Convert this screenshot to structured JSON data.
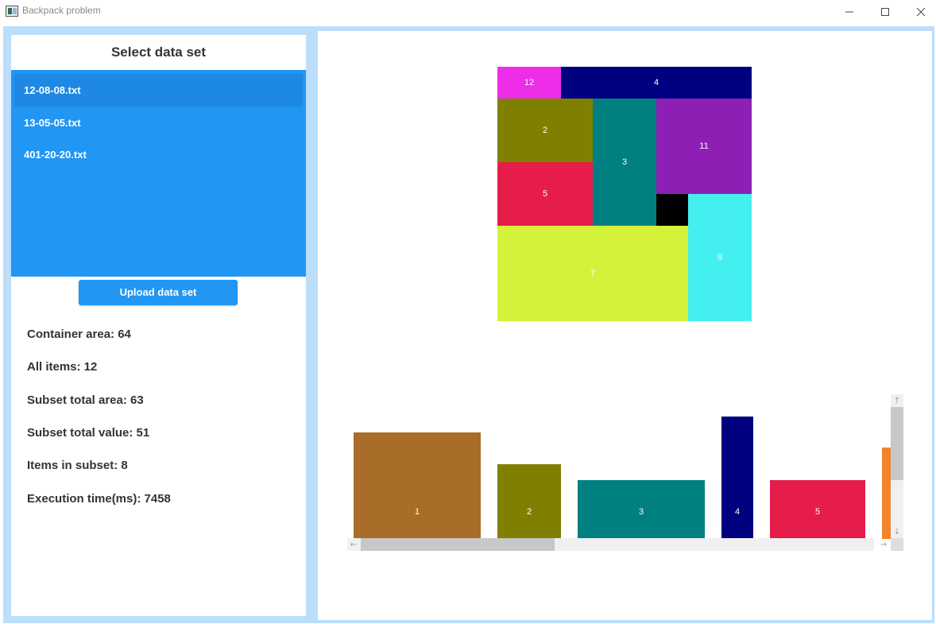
{
  "window": {
    "title": "Backpack problem",
    "minimize_icon": "minimize-icon",
    "maximize_icon": "maximize-icon",
    "close_icon": "close-icon"
  },
  "sidebar": {
    "title": "Select data set",
    "files": [
      "12-08-08.txt",
      "13-05-05.txt",
      "401-20-20.txt"
    ],
    "selected_file": "12-08-08.txt",
    "upload_label": "Upload data set",
    "accent_color": "#2196f3"
  },
  "stats": {
    "container_area": "Container area: 64",
    "all_items": "All items: 12",
    "subset_total_area": "Subset total area: 63",
    "subset_total_value": "Subset total value: 51",
    "items_in_subset": "Items in subset: 8",
    "execution_time": "Execution time(ms): 7458"
  },
  "container": {
    "grid_size": 8,
    "placements": [
      {
        "id": "12",
        "col": 0,
        "row": 0,
        "w": 2,
        "h": 1,
        "color": "#ee2de8"
      },
      {
        "id": "4",
        "col": 2,
        "row": 0,
        "w": 6,
        "h": 1,
        "color": "#000080"
      },
      {
        "id": "2",
        "col": 0,
        "row": 1,
        "w": 3,
        "h": 2,
        "color": "#808000"
      },
      {
        "id": "3",
        "col": 3,
        "row": 1,
        "w": 2,
        "h": 4,
        "color": "#008080"
      },
      {
        "id": "11",
        "col": 5,
        "row": 1,
        "w": 3,
        "h": 3,
        "color": "#8e1fb5"
      },
      {
        "id": "5",
        "col": 0,
        "row": 3,
        "w": 3,
        "h": 2,
        "color": "#e61c4a"
      },
      {
        "id": "",
        "col": 5,
        "row": 4,
        "w": 1,
        "h": 1,
        "color": "#000000"
      },
      {
        "id": "7",
        "col": 0,
        "row": 5,
        "w": 6,
        "h": 3,
        "color": "#d4f23a"
      },
      {
        "id": "9",
        "col": 6,
        "row": 4,
        "w": 2,
        "h": 4,
        "color": "#44f0ef"
      }
    ]
  },
  "items_strip": {
    "items": [
      {
        "id": "1",
        "w": 4,
        "h": 3.35,
        "color": "#a86d28"
      },
      {
        "id": "2",
        "w": 2,
        "h": 2.35,
        "color": "#808000"
      },
      {
        "id": "3",
        "w": 4,
        "h": 1.85,
        "color": "#008080"
      },
      {
        "id": "4",
        "w": 1,
        "h": 3.85,
        "color": "#000080"
      },
      {
        "id": "5",
        "w": 3,
        "h": 1.85,
        "color": "#e61c4a"
      }
    ],
    "partial_item_color": "#f0852d"
  },
  "scrollbars": {
    "up_arrow": "↑",
    "down_arrow": "↓",
    "left_arrow": "←",
    "right_arrow": "→"
  }
}
